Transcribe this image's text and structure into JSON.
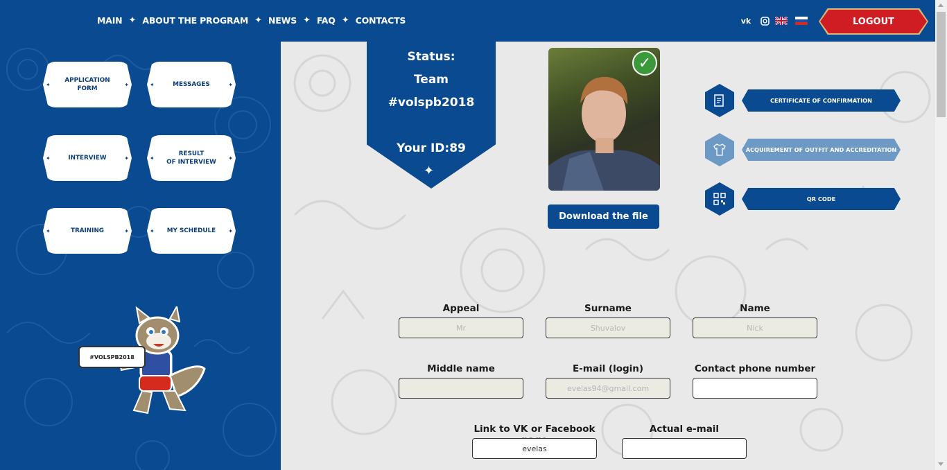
{
  "nav": {
    "items": [
      "MAIN",
      "ABOUT THE PROGRAM",
      "NEWS",
      "FAQ",
      "CONTACTS"
    ],
    "separator": "✦",
    "social": {
      "vk": "vk"
    },
    "logout": "LOGOUT"
  },
  "sidebar": {
    "tiles": [
      "APPLICATION\nFORM",
      "MESSAGES",
      "INTERVIEW",
      "RESULT\nOF INTERVIEW",
      "TRAINING",
      "MY SCHEDULE"
    ],
    "mascot_sign": "#VOLSPB2018"
  },
  "status": {
    "label": "Status:",
    "value_line1": "Team",
    "value_line2": "#volspb2018",
    "id": "Your ID:89"
  },
  "photo": {
    "check_icon": "checkmark-icon"
  },
  "download_button": "Download the file",
  "actions": [
    {
      "label": "CERTIFICATE OF CONFIRMATION",
      "icon": "document-icon",
      "enabled": true
    },
    {
      "label": "ACQUIREMENT OF OUTFIT AND ACCREDITATION",
      "icon": "tshirt-icon",
      "enabled": false
    },
    {
      "label": "QR CODE",
      "icon": "qr-icon",
      "enabled": true
    }
  ],
  "form": {
    "appeal": {
      "label": "Appeal",
      "placeholder": "Mr",
      "value": ""
    },
    "surname": {
      "label": "Surname",
      "placeholder": "Shuvalov",
      "value": ""
    },
    "name": {
      "label": "Name",
      "placeholder": "Nick",
      "value": ""
    },
    "middle_name": {
      "label": "Middle name",
      "placeholder": "",
      "value": ""
    },
    "email": {
      "label": "E-mail (login)",
      "placeholder": "evelas94@gmail.com",
      "value": ""
    },
    "phone": {
      "label": "Contact phone number",
      "placeholder": "",
      "value": ""
    },
    "vk_link": {
      "label": "Link to VK or Facebook page",
      "placeholder": "",
      "value": "evelas"
    },
    "actual_email": {
      "label": "Actual e-mail",
      "placeholder": "",
      "value": ""
    }
  },
  "colors": {
    "brand_blue": "#0a4a90",
    "logout_red": "#d01c23",
    "disabled_blue": "#6d99c5"
  }
}
